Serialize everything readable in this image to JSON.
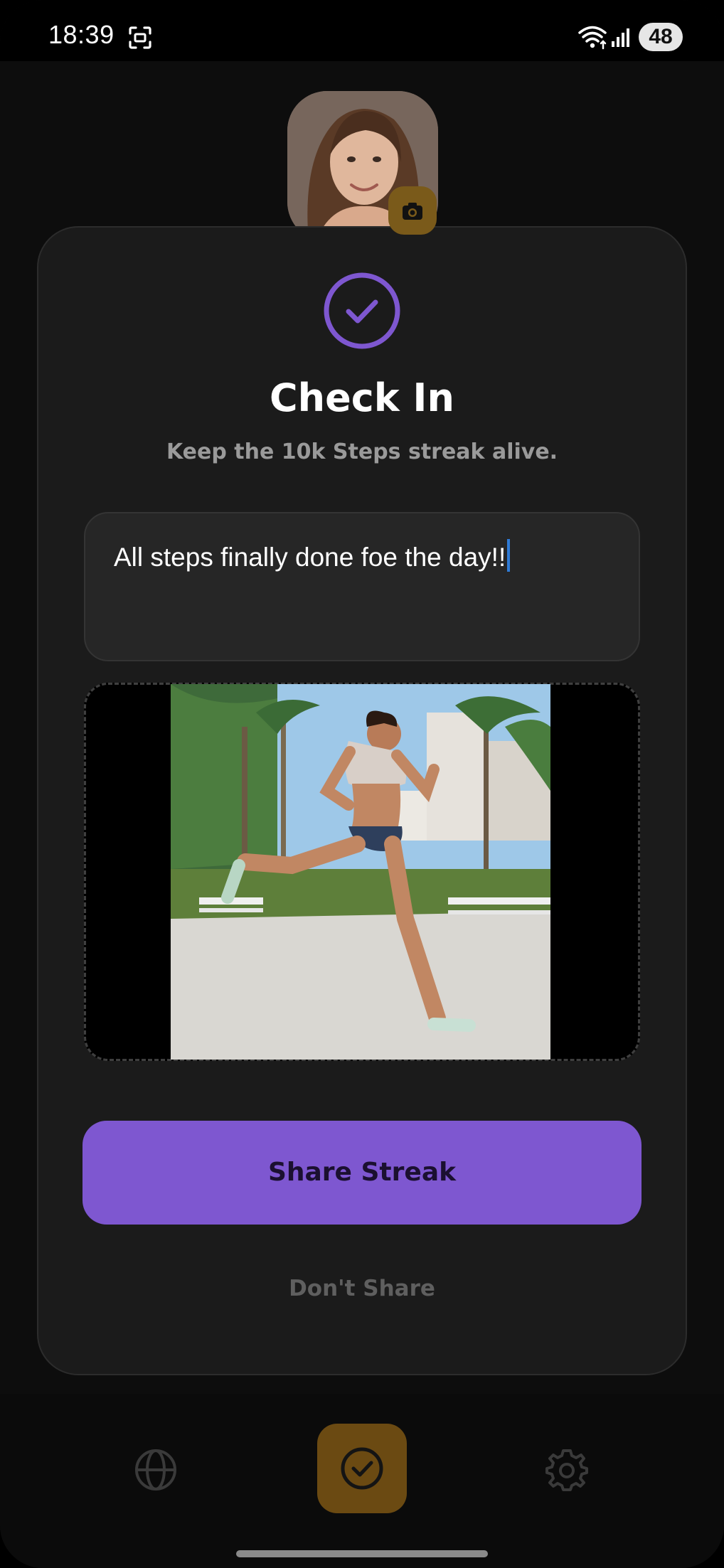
{
  "status_bar": {
    "time": "18:39",
    "battery": "48",
    "icons": [
      "screenshot-icon",
      "wifi-icon",
      "signal-icon"
    ]
  },
  "header": {
    "avatar_icon": "avatar",
    "camera_icon": "camera-icon"
  },
  "dialog": {
    "icon": "check-circle-icon",
    "title": "Check In",
    "subtitle": "Keep the 10k Steps streak alive.",
    "note_value": "All steps finally done foe the day!!",
    "photo_icon": "photo-preview",
    "primary_button": "Share Streak",
    "secondary_button": "Don't Share"
  },
  "bottom_nav": {
    "items": [
      "globe-icon",
      "check-circle-icon",
      "gear-icon"
    ]
  },
  "colors": {
    "accent": "#7e57d0",
    "card_bg": "#1b1b1b",
    "nav_highlight": "#6b4a12",
    "cursor": "#2f7bd6"
  }
}
